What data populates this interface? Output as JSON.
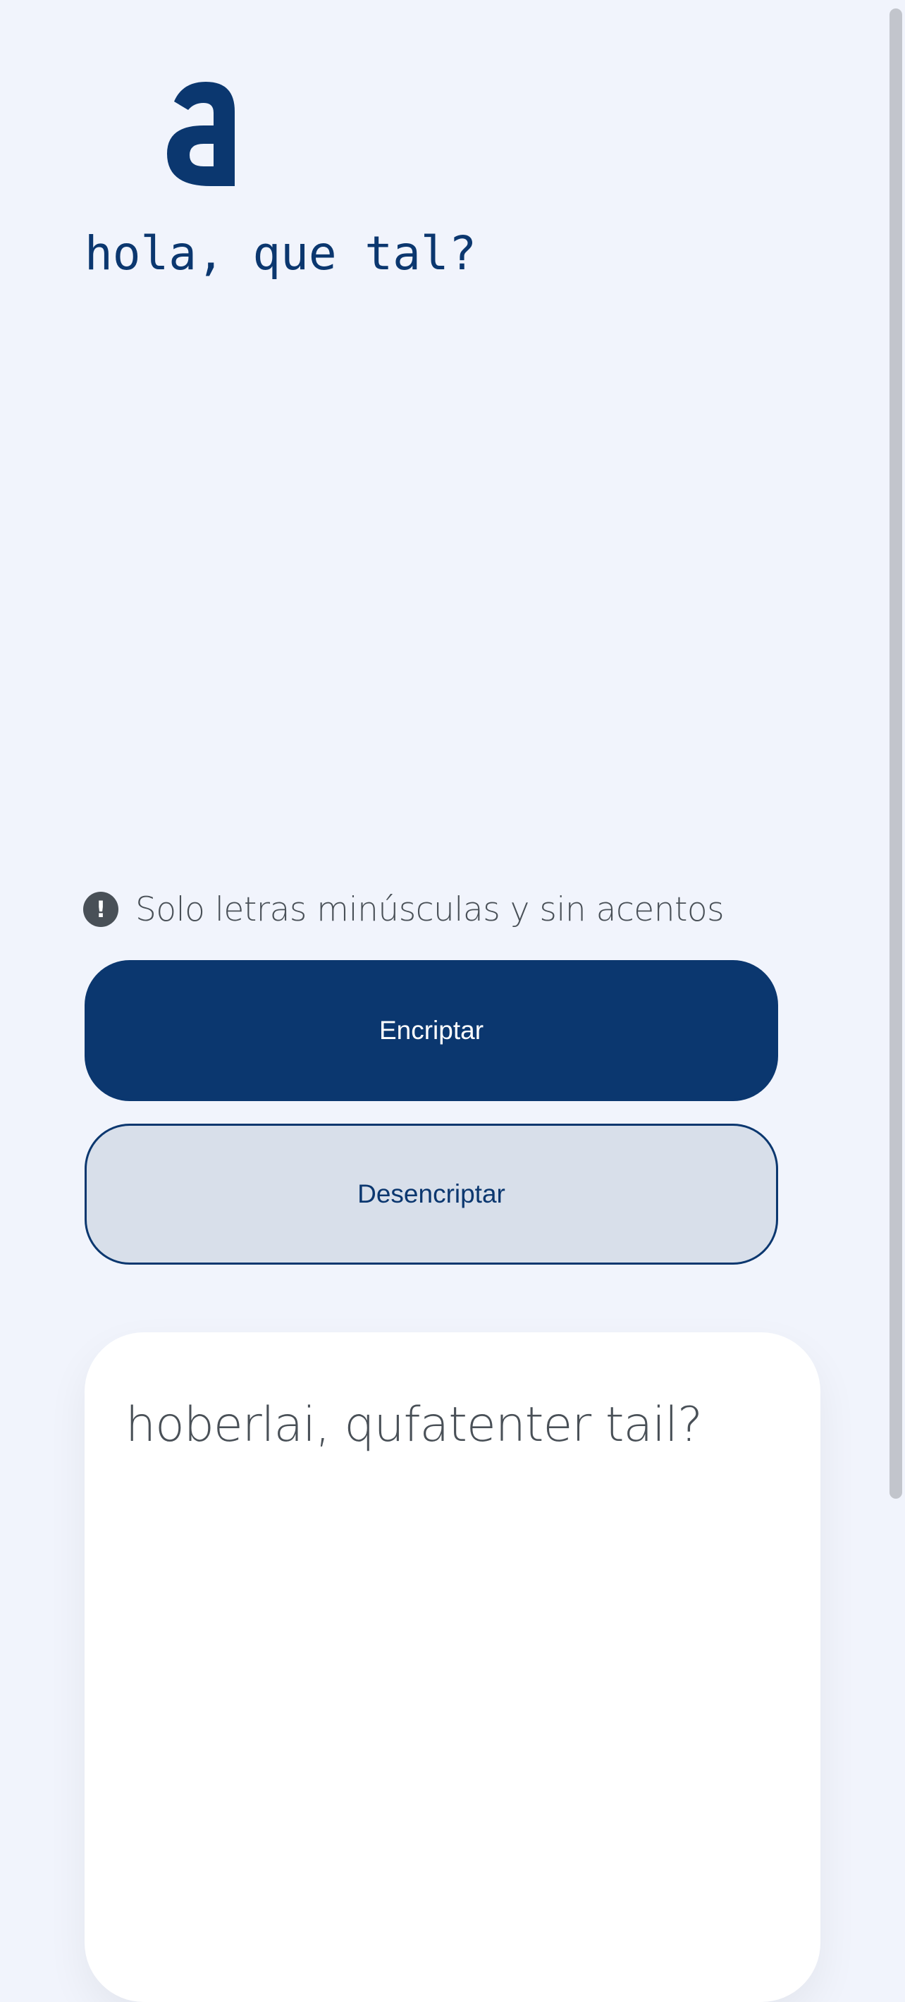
{
  "logo": {
    "icon": "alura-a-logo",
    "color": "#0b376f"
  },
  "input": {
    "value": "hola, que tal?",
    "color": "#0b376f"
  },
  "hint": {
    "icon": "exclamation-circle-icon",
    "icon_glyph": "!",
    "text": "Solo letras minúsculas y sin acentos"
  },
  "buttons": {
    "encrypt_label": "Encriptar",
    "decrypt_label": "Desencriptar"
  },
  "output": {
    "text": "hoberlai, qufatenter tail?"
  },
  "colors": {
    "accent": "#0b376f",
    "background": "#f1f4fc",
    "secondary_button": "#d8dfea",
    "muted_text": "#495057"
  }
}
